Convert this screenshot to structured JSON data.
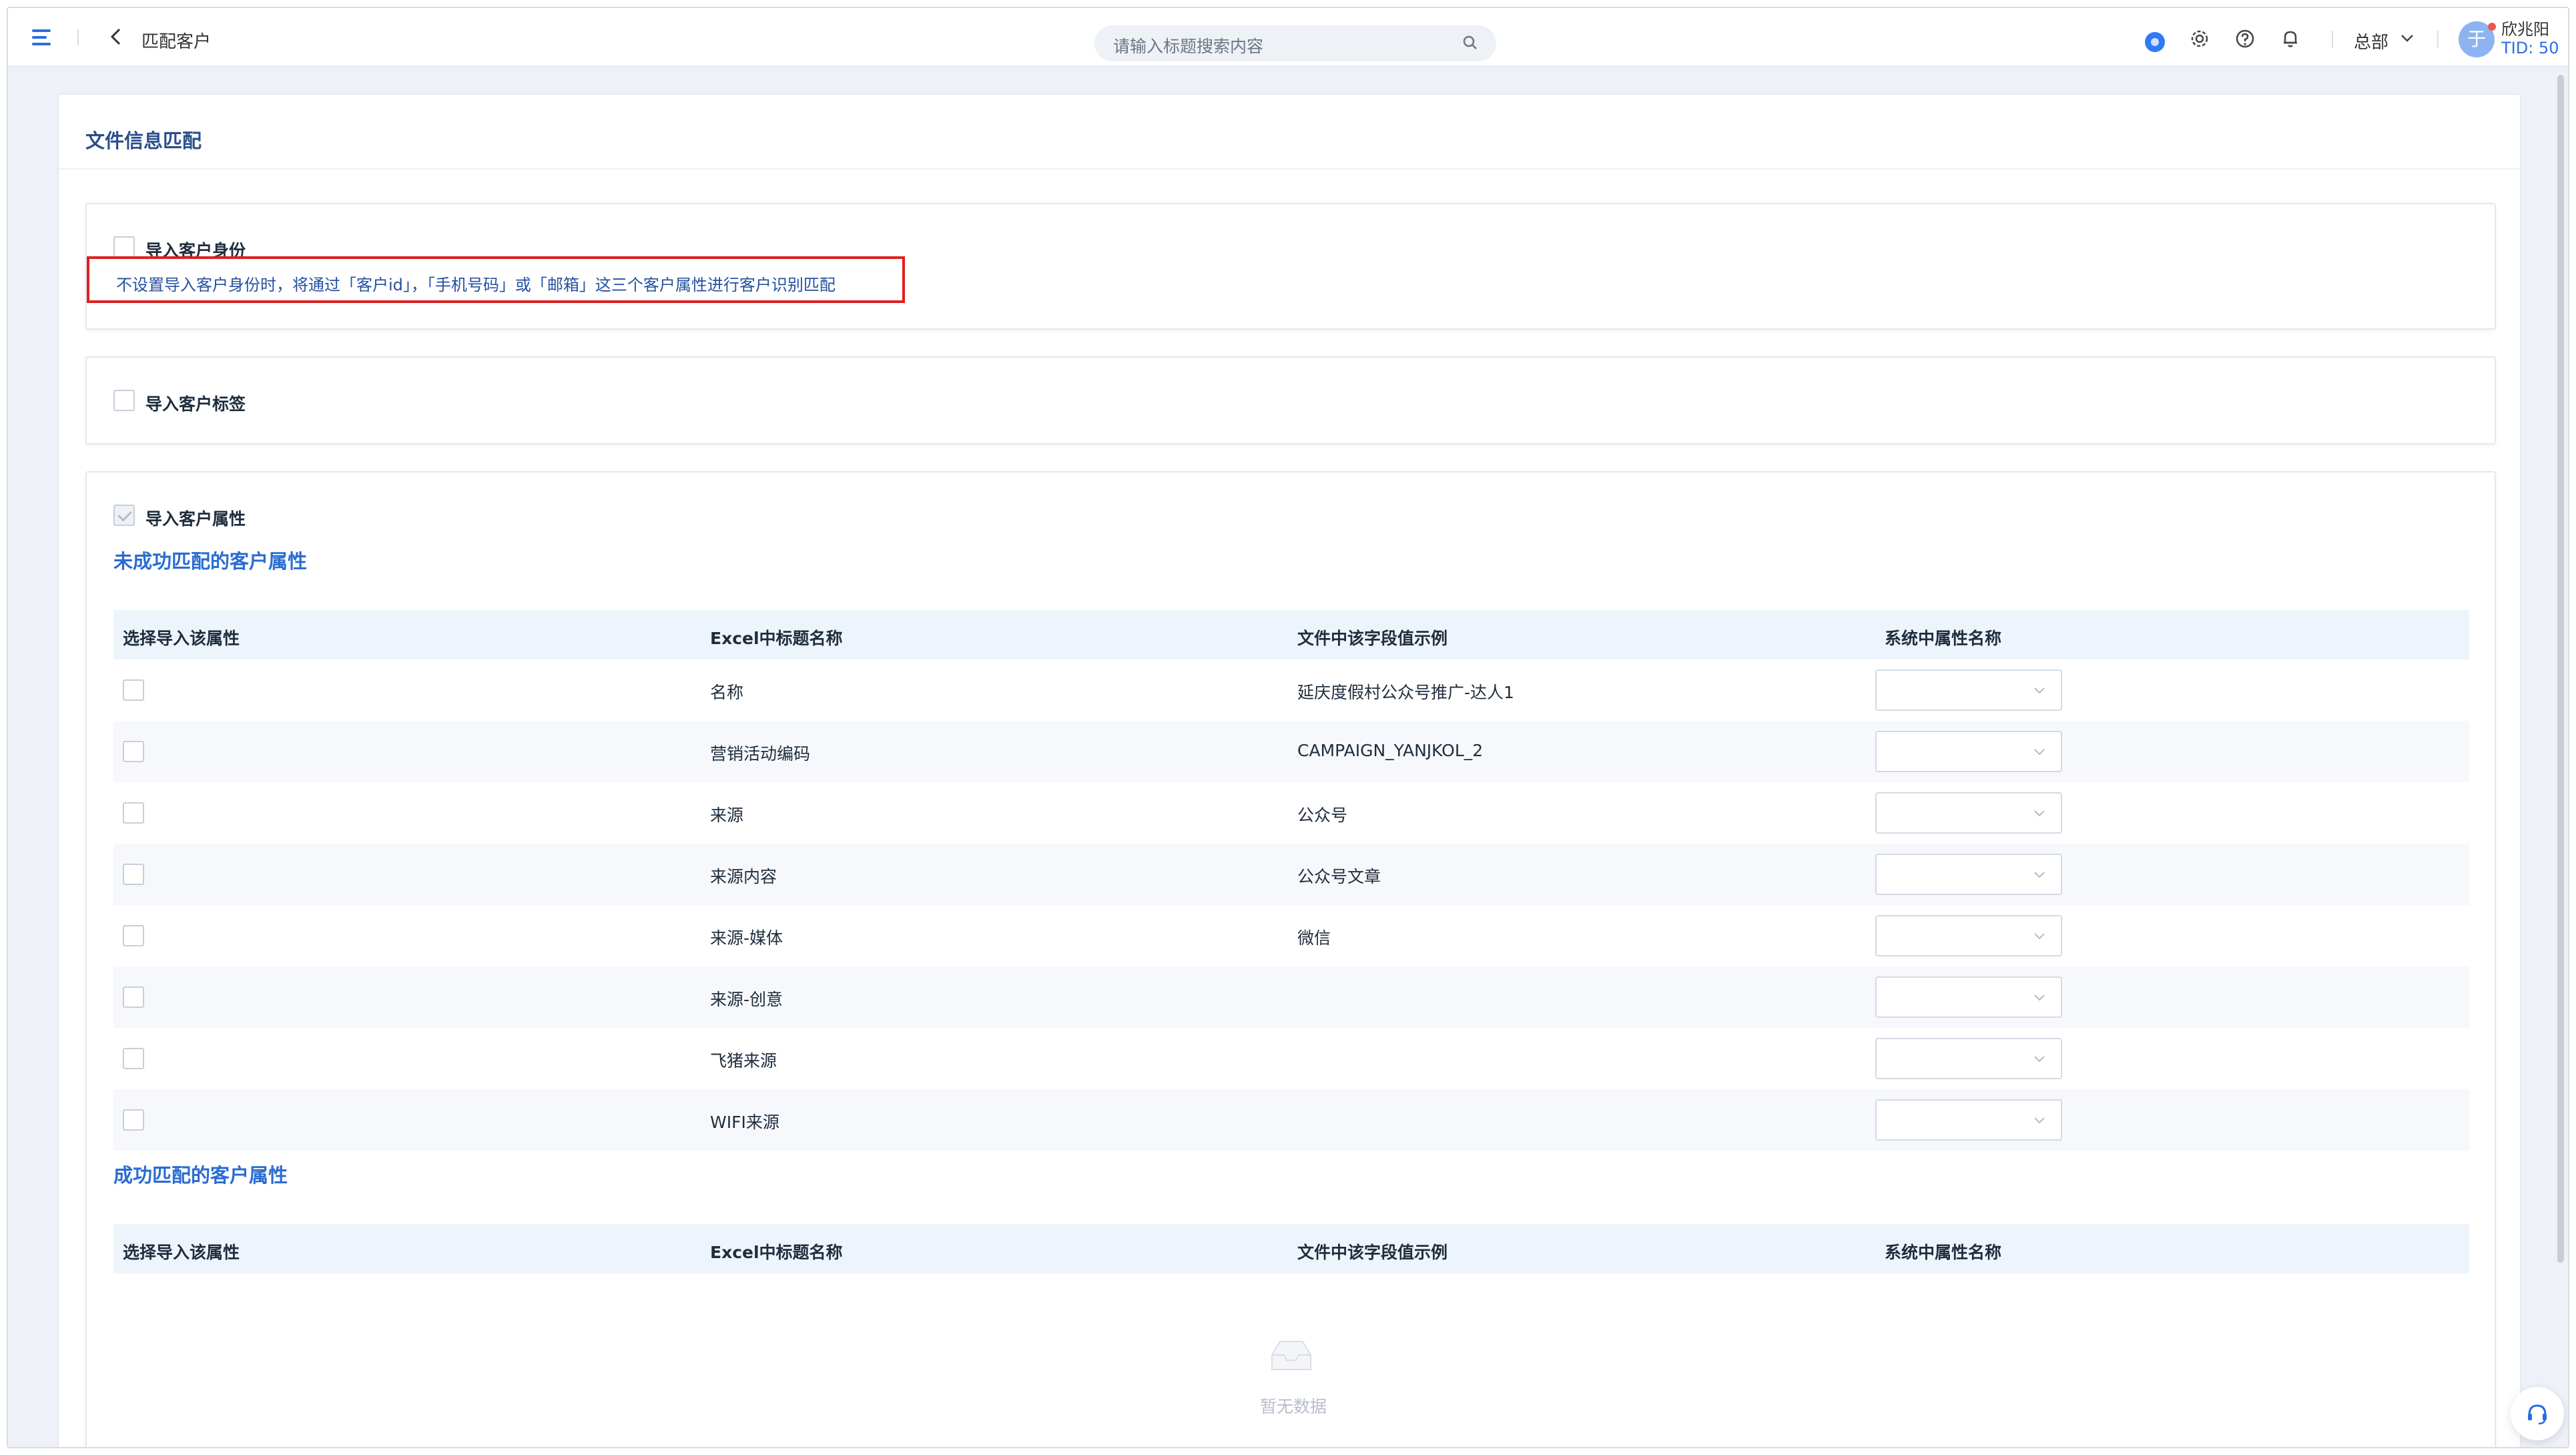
{
  "header": {
    "back_icon": "chevron-left-icon",
    "title": "匹配客户",
    "search_placeholder": "请输入标题搜索内容",
    "org": "总部",
    "user": {
      "avatar": "于",
      "name": "欣兆阳",
      "tid": "TID: 50"
    }
  },
  "card": {
    "title": "文件信息匹配",
    "identity": {
      "label": "导入客户身份",
      "hint": "不设置导入客户身份时，将通过「客户id」，「手机号码」或「邮箱」这三个客户属性进行客户识别匹配"
    },
    "tags": {
      "label": "导入客户标签"
    },
    "attributes": {
      "label": "导入客户属性",
      "unmatched_title": "未成功匹配的客户属性",
      "columns": [
        "选择导入该属性",
        "Excel中标题名称",
        "文件中该字段值示例",
        "系统中属性名称"
      ],
      "rows": [
        {
          "name": "名称",
          "example": "延庆度假村公众号推广-达人1"
        },
        {
          "name": "营销活动编码",
          "example": "CAMPAIGN_YANJKOL_2"
        },
        {
          "name": "来源",
          "example": "公众号"
        },
        {
          "name": "来源内容",
          "example": "公众号文章"
        },
        {
          "name": "来源-媒体",
          "example": "微信"
        },
        {
          "name": "来源-创意",
          "example": ""
        },
        {
          "name": "飞猪来源",
          "example": ""
        },
        {
          "name": "WIFI来源",
          "example": ""
        }
      ],
      "matched_title": "成功匹配的客户属性",
      "empty_text": "暂无数据"
    }
  },
  "colors": {
    "accent": "#2a6cd2",
    "highlight_border": "#e02020"
  }
}
